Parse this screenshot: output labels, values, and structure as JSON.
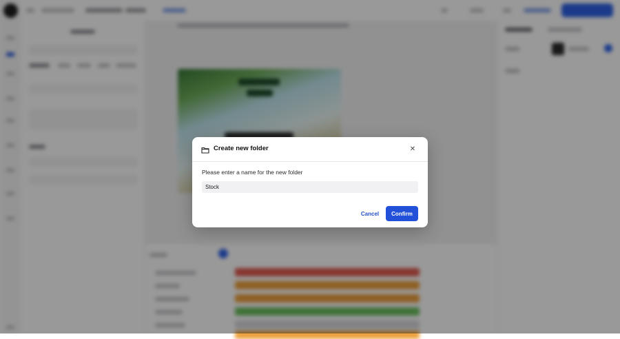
{
  "dialog": {
    "title": "Create new folder",
    "prompt": "Please enter a name for the new folder",
    "input_value": "Stock",
    "cancel_label": "Cancel",
    "confirm_label": "Confirm",
    "icons": {
      "header": "folder-icon",
      "close": "close-icon"
    }
  },
  "colors": {
    "accent": "#2350d8",
    "overlay": "rgba(0,0,0,0.40)",
    "track_red": "#e05a4d",
    "track_orange": "#eda03c",
    "track_green": "#6cbf5d",
    "track_gray": "#d8d8dc"
  }
}
